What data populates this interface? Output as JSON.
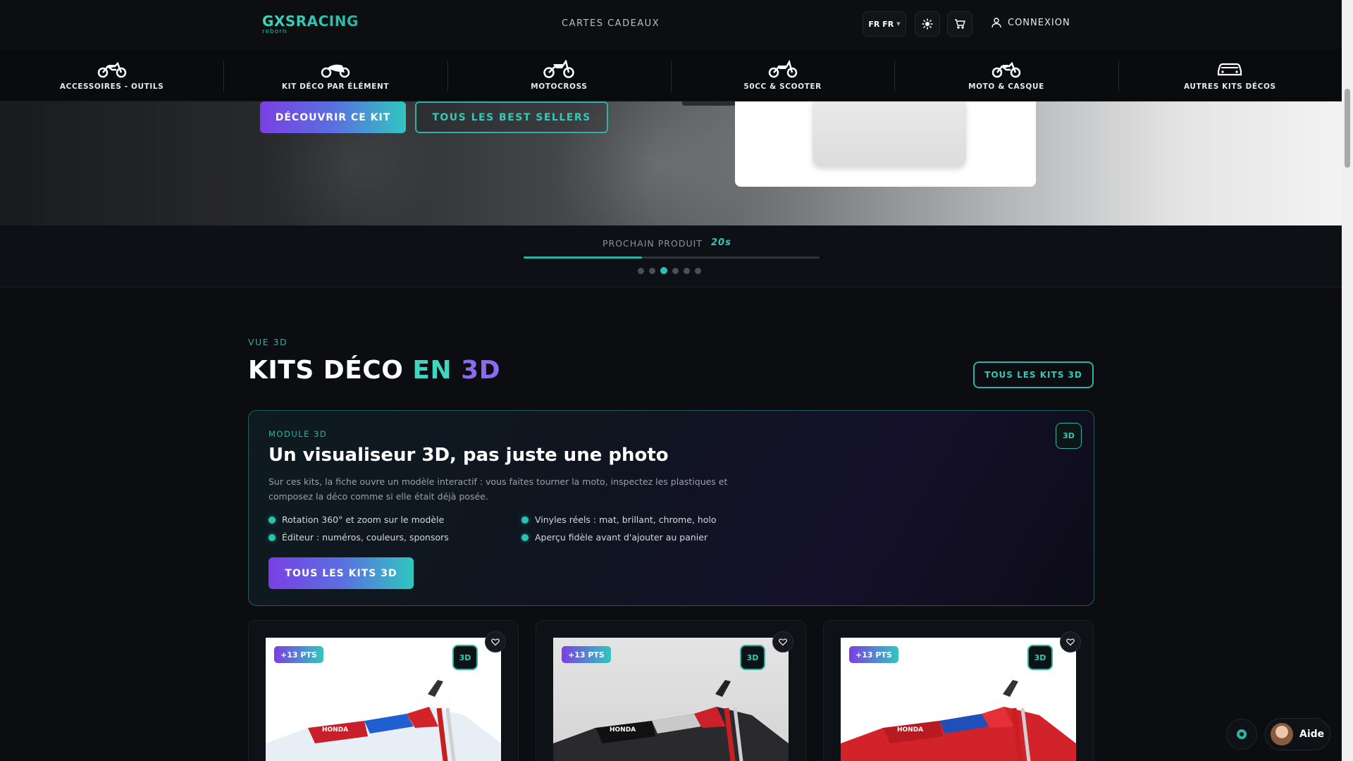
{
  "header": {
    "logo": "GXSRACING",
    "logo_sub": "reborn",
    "gift_cards": "CARTES CADEAUX",
    "lang_label": "FR",
    "lang_value": "FR",
    "login": "CONNEXION"
  },
  "categories": [
    {
      "label": "ACCESSOIRES - OUTILS",
      "icon": "motorcycle-icon"
    },
    {
      "label": "KIT DÉCO PAR ÉLÉMENT",
      "icon": "motorcycle-icon"
    },
    {
      "label": "MOTOCROSS",
      "icon": "dirt-bike-icon"
    },
    {
      "label": "50CC & SCOOTER",
      "icon": "scooter-icon"
    },
    {
      "label": "MOTO & CASQUE",
      "icon": "motorcycle-icon"
    },
    {
      "label": "AUTRES KITS DÉCOS",
      "icon": "car-icon"
    }
  ],
  "hero": {
    "discover_btn": "DÉCOUVRIR CE KIT",
    "best_sellers_btn": "TOUS LES BEST SELLERS"
  },
  "next_product": {
    "label": "PROCHAIN PRODUIT",
    "countdown": "20s",
    "progress": 0.4,
    "slide_count": 6,
    "active_slide": 3
  },
  "section": {
    "tag": "VUE 3D",
    "title_main": "KITS DÉCO",
    "title_en": "EN",
    "title_3d": "3D",
    "all_kits_btn": "TOUS LES KITS 3D"
  },
  "module": {
    "tag": "MODULE 3D",
    "title": "Un visualiseur 3D, pas juste une photo",
    "description": "Sur ces kits, la fiche ouvre un modèle interactif : vous faites tourner la moto, inspectez les plastiques et composez la déco comme si elle était déjà posée.",
    "features": [
      "Rotation 360° et zoom sur le modèle",
      "Vinyles réels : mat, brillant, chrome, holo",
      "Éditeur : numéros, couleurs, sponsors",
      "Aperçu fidèle avant d'ajouter au panier"
    ],
    "cta": "TOUS LES KITS 3D",
    "badge": "3D"
  },
  "products": [
    {
      "points": "+13 PTS",
      "badge": "3D",
      "theme": "white-red-blue"
    },
    {
      "points": "+13 PTS",
      "badge": "3D",
      "theme": "black-red"
    },
    {
      "points": "+13 PTS",
      "badge": "3D",
      "theme": "red-blue"
    }
  ],
  "help": {
    "label": "Aide"
  },
  "colors": {
    "accent": "#2bb3a6",
    "purple": "#7b3fe4",
    "bg": "#0b0d11"
  }
}
